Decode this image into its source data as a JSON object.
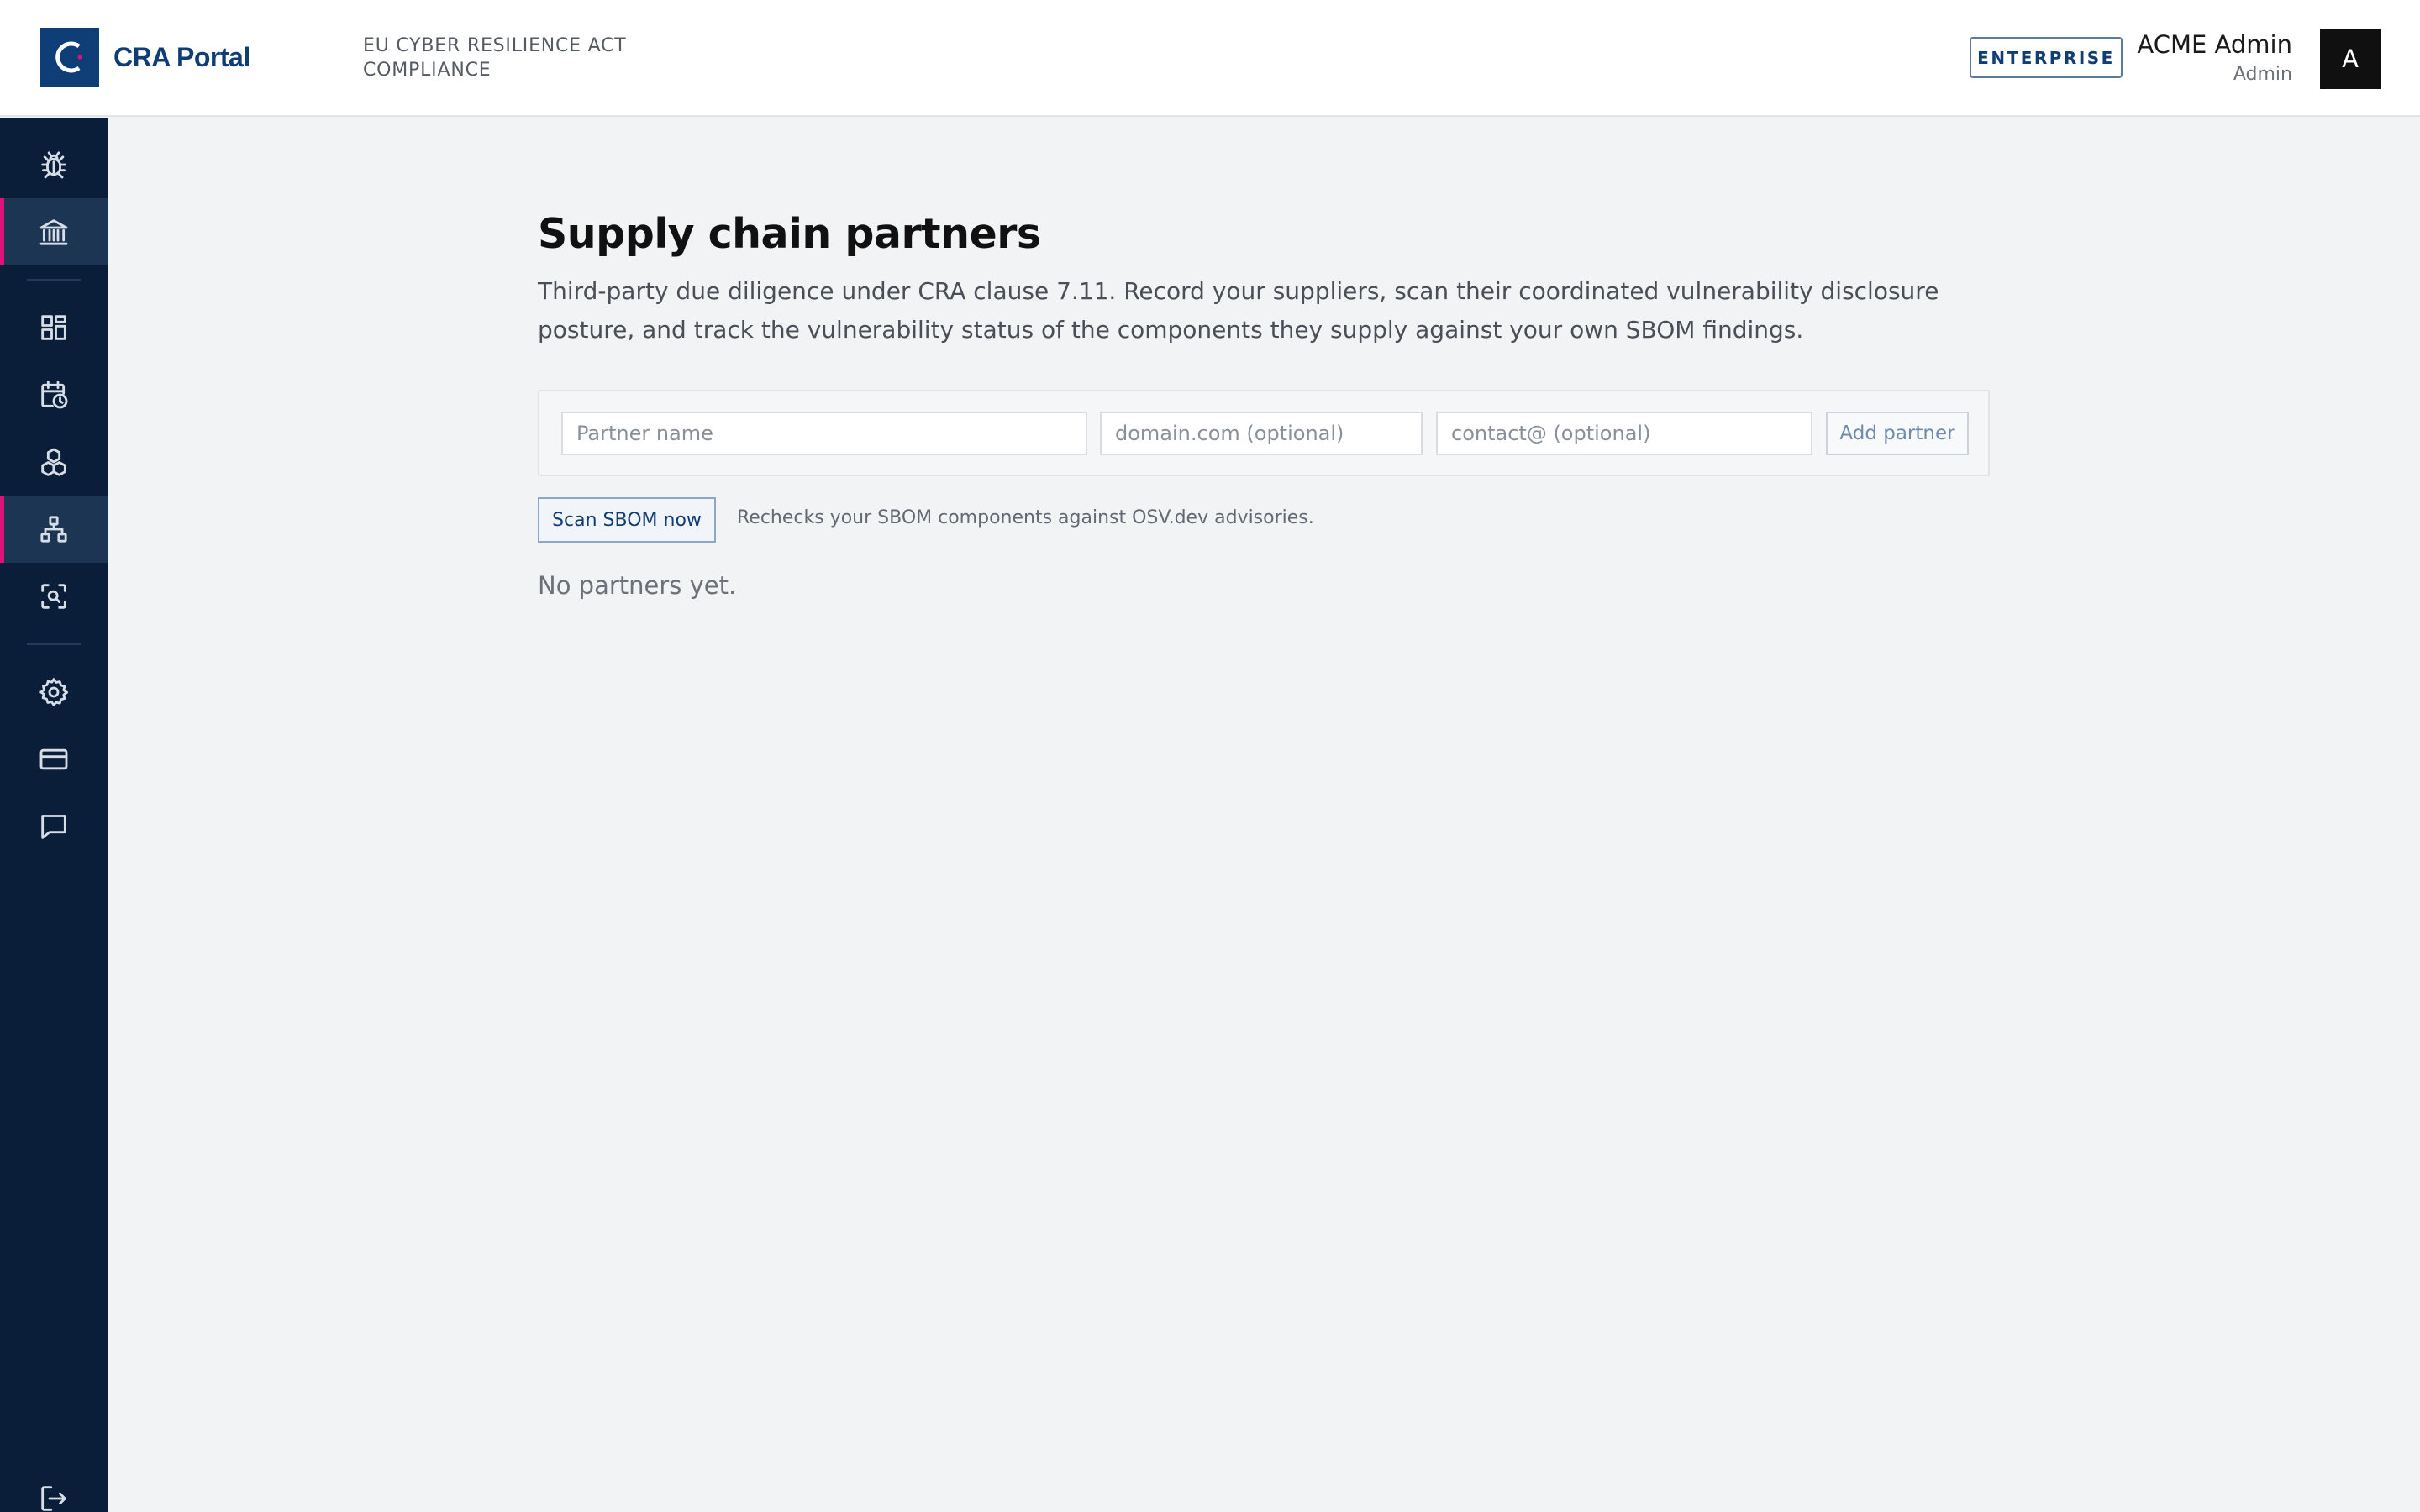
{
  "header": {
    "brand": "CRA Portal",
    "tagline": "EU CYBER RESILIENCE ACT COMPLIANCE",
    "plan_badge": "ENTERPRISE",
    "user_name": "ACME Admin",
    "user_role": "Admin",
    "avatar_initial": "A"
  },
  "sidebar": {
    "items": [
      {
        "icon": "bug-icon",
        "active": false
      },
      {
        "icon": "bank-icon",
        "active": true
      },
      {
        "icon": "dashboard-icon",
        "active": false
      },
      {
        "icon": "calendar-clock-icon",
        "active": false
      },
      {
        "icon": "cubes-icon",
        "active": false
      },
      {
        "icon": "hierarchy-icon",
        "active": true
      },
      {
        "icon": "scan-search-icon",
        "active": false
      },
      {
        "icon": "gear-icon",
        "active": false
      },
      {
        "icon": "credit-card-icon",
        "active": false
      },
      {
        "icon": "chat-icon",
        "active": false
      },
      {
        "icon": "logout-icon",
        "active": false
      }
    ],
    "accent_color": "#e0127a"
  },
  "main": {
    "title": "Supply chain partners",
    "description": "Third-party due diligence under CRA clause 7.11. Record your suppliers, scan their coordinated vulnerability disclosure posture, and track the vulnerability status of the components they supply against your own SBOM findings.",
    "form": {
      "partner_name_placeholder": "Partner name",
      "domain_placeholder": "domain.com (optional)",
      "contact_placeholder": "contact@ (optional)",
      "add_label": "Add partner"
    },
    "scan_label": "Scan SBOM now",
    "scan_note": "Rechecks your SBOM components against OSV.dev advisories.",
    "empty_state": "No partners yet."
  },
  "colors": {
    "brand": "#0f3e77",
    "sidebar_bg": "#0a1e3a",
    "page_bg": "#f2f3f5"
  }
}
